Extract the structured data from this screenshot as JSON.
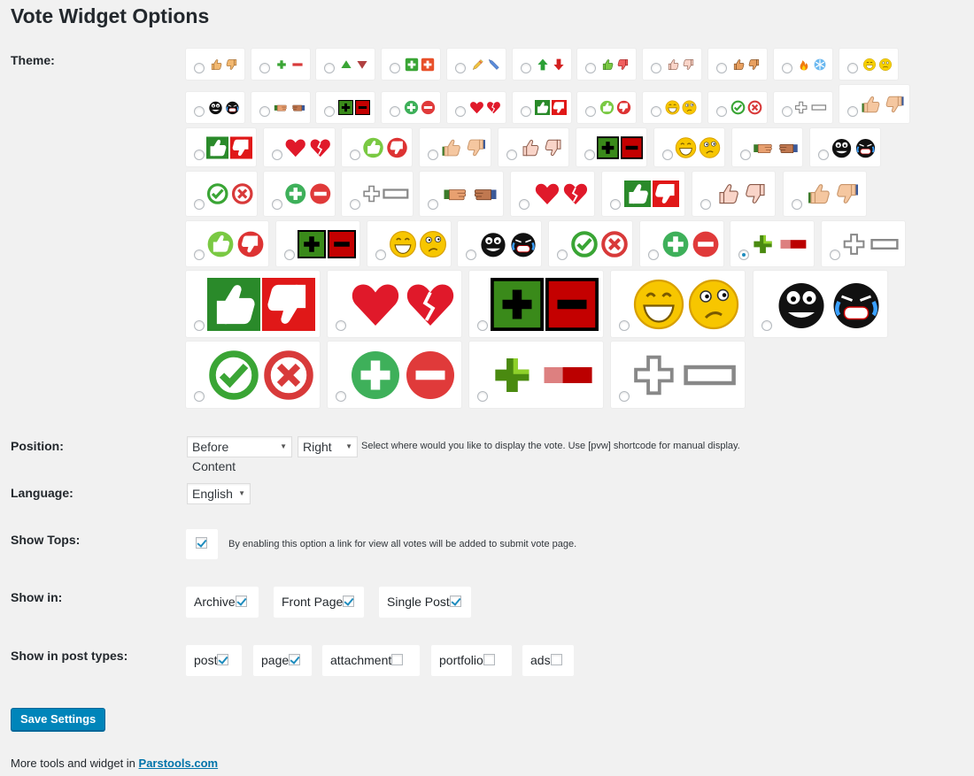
{
  "title": "Vote Widget Options",
  "labels": {
    "theme": "Theme:",
    "position": "Position:",
    "language": "Language:",
    "show_tops": "Show Tops:",
    "show_in": "Show in:",
    "show_in_post_types": "Show in post types:"
  },
  "themes": [
    {
      "icon": "thumbs-gold",
      "selected": false
    },
    {
      "icon": "plus-minus-flat",
      "selected": false
    },
    {
      "icon": "arrows-tri",
      "selected": false
    },
    {
      "icon": "square-plusminus-green",
      "selected": false
    },
    {
      "icon": "pencil-pair",
      "selected": false
    },
    {
      "icon": "arrows-up-down",
      "selected": false
    },
    {
      "icon": "thumbs-color",
      "selected": false
    },
    {
      "icon": "pink-hands",
      "selected": false
    },
    {
      "icon": "thumbs-brown",
      "selected": false
    },
    {
      "icon": "fire-snow",
      "selected": false
    },
    {
      "icon": "smileys-yellow",
      "selected": false
    },
    {
      "icon": "black-faces",
      "selected": false
    },
    {
      "icon": "hands-shake",
      "selected": false
    },
    {
      "icon": "black-box-pm",
      "selected": false
    },
    {
      "icon": "circle-pm",
      "selected": false
    },
    {
      "icon": "hearts",
      "selected": false
    },
    {
      "icon": "green-red-thumbs",
      "selected": false
    },
    {
      "icon": "green-red-circle-thumbs",
      "selected": false
    },
    {
      "icon": "smileys-laugh",
      "selected": false
    },
    {
      "icon": "check-x",
      "selected": false
    },
    {
      "icon": "outline-pm",
      "selected": false
    },
    {
      "icon": "blue-thumbs",
      "selected": false
    },
    {
      "icon": "green-red-thumbs",
      "selected": false
    },
    {
      "icon": "hearts",
      "selected": false
    },
    {
      "icon": "green-red-circle-thumbs",
      "selected": false
    },
    {
      "icon": "blue-thumbs",
      "selected": false
    },
    {
      "icon": "pink-hands",
      "selected": false
    },
    {
      "icon": "black-box-pm",
      "selected": false
    },
    {
      "icon": "smileys-laugh",
      "selected": false
    },
    {
      "icon": "hands-shake",
      "selected": false
    },
    {
      "icon": "black-faces",
      "selected": false
    },
    {
      "icon": "check-x",
      "selected": false
    },
    {
      "icon": "circle-pm",
      "selected": false
    },
    {
      "icon": "outline-pm",
      "selected": false
    },
    {
      "icon": "hands-shake",
      "selected": false
    },
    {
      "icon": "hearts",
      "selected": false
    },
    {
      "icon": "green-red-thumbs",
      "selected": false
    },
    {
      "icon": "pink-hands",
      "selected": false
    },
    {
      "icon": "blue-thumbs",
      "selected": false
    },
    {
      "icon": "green-red-circle-thumbs",
      "selected": false
    },
    {
      "icon": "black-box-pm",
      "selected": false
    },
    {
      "icon": "smileys-laugh",
      "selected": false
    },
    {
      "icon": "black-faces",
      "selected": false
    },
    {
      "icon": "check-x",
      "selected": false
    },
    {
      "icon": "circle-pm",
      "selected": false
    },
    {
      "icon": "shaded-pm",
      "selected": true
    },
    {
      "icon": "outline-pm",
      "selected": false
    },
    {
      "icon": "green-red-thumbs",
      "selected": false
    },
    {
      "icon": "hearts",
      "selected": false
    },
    {
      "icon": "black-box-pm",
      "selected": false
    },
    {
      "icon": "smileys-laugh",
      "selected": false
    },
    {
      "icon": "black-faces",
      "selected": false
    },
    {
      "icon": "check-x",
      "selected": false
    },
    {
      "icon": "circle-pm",
      "selected": false
    },
    {
      "icon": "shaded-pm",
      "selected": false
    },
    {
      "icon": "outline-pm",
      "selected": false
    }
  ],
  "position": {
    "content_select": "Before Content",
    "side_select": "Right",
    "help": "Select where would you like to display the vote. Use [pvw] shortcode for manual display."
  },
  "language": {
    "select": "English"
  },
  "show_tops": {
    "checked": true,
    "help": "By enabling this option a link for view all votes will be added to submit vote page."
  },
  "show_in": [
    {
      "label": "Archive",
      "checked": true
    },
    {
      "label": "Front Page",
      "checked": true
    },
    {
      "label": "Single Post",
      "checked": true
    }
  ],
  "post_types": [
    {
      "label": "post",
      "checked": true
    },
    {
      "label": "page",
      "checked": true
    },
    {
      "label": "attachment",
      "checked": false
    },
    {
      "label": "portfolio",
      "checked": false
    },
    {
      "label": "ads",
      "checked": false
    }
  ],
  "save_button": "Save Settings",
  "footer": {
    "text": "More tools and widget in ",
    "link": "Parstools.com"
  }
}
